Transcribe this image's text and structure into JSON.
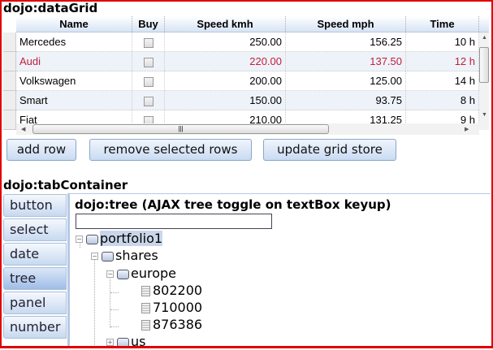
{
  "grid_title": "dojo:dataGrid",
  "grid": {
    "columns": [
      "Name",
      "Buy",
      "Speed kmh",
      "Speed mph",
      "Time"
    ],
    "rows": [
      {
        "name": "Mercedes",
        "kmh": "250.00",
        "mph": "156.25",
        "time": "10 h"
      },
      {
        "name": "Audi",
        "kmh": "220.00",
        "mph": "137.50",
        "time": "12 h"
      },
      {
        "name": "Volkswagen",
        "kmh": "200.00",
        "mph": "125.00",
        "time": "14 h"
      },
      {
        "name": "Smart",
        "kmh": "150.00",
        "mph": "93.75",
        "time": "8 h"
      },
      {
        "name": "Fiat",
        "kmh": "210.00",
        "mph": "131.25",
        "time": "9 h"
      }
    ],
    "highlight_color": "#c0203a"
  },
  "buttons": {
    "add": "add row",
    "remove": "remove selected rows",
    "update": "update grid store"
  },
  "tab_title": "dojo:tabContainer",
  "tabs": [
    "button",
    "select",
    "date",
    "tree",
    "panel",
    "number"
  ],
  "tree_panel": {
    "title": "dojo:tree (AJAX tree toggle on textBox keyup)",
    "input_value": "",
    "nodes": {
      "root": "portfolio1",
      "shares": "shares",
      "europe": "europe",
      "n1": "802200",
      "n2": "710000",
      "n3": "876386",
      "us": "us"
    }
  }
}
